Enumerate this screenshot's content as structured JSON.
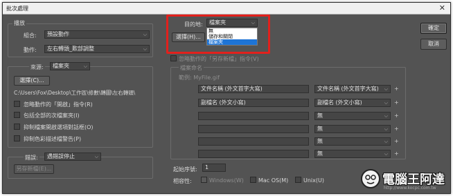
{
  "window": {
    "title": "批次處理",
    "close": "✕"
  },
  "play": {
    "group_label": "播放",
    "set_label": "組合:",
    "set_value": "預設動作",
    "action_label": "動作:",
    "action_value": "左右轉頭_歎部調整"
  },
  "source": {
    "label": "來源:",
    "value": "檔案夾",
    "choose": "選擇(C)...",
    "path": "C:\\Users\\Fox\\Desktop\\工作區\\修數\\轉圖\\左右轉頭\\",
    "options": [
      "忽略動作的「開啟」指令(R)",
      "包括全部的次檔案夾(I)",
      "抑制檔案開啟選項對話框(O)",
      "抑制色彩描述檔警告(P)"
    ]
  },
  "errors": {
    "label": "錯誤:",
    "value": "遇錯誤停止",
    "save_as": "另存新檔(E)..."
  },
  "destination": {
    "label": "目的地:",
    "value": "檔案夾",
    "choose": "選擇(H)...",
    "options": [
      "無",
      "儲存和關閉",
      "檔案夾"
    ],
    "override": "忽略動作的「另存新檔」指令(V)"
  },
  "naming": {
    "title": "檔案命名",
    "example": "範例: MyFile.gif",
    "left": [
      "文件名稱 (外文首字大寫)",
      "副檔名 (外文小寫)",
      "",
      "",
      "",
      ""
    ],
    "right": [
      "文件名稱 (外文首字大寫)",
      "副檔名 (外文小寫)",
      "無",
      "無",
      "無",
      "無"
    ],
    "serial_label": "起始序號:",
    "serial_value": "1",
    "compat_label": "相容性:",
    "compat": [
      "Windows(W)",
      "Mac OS(M)",
      "Unix(U)"
    ]
  },
  "buttons": {
    "ok": "確定",
    "cancel": "取消"
  },
  "watermark": {
    "text": "電腦王阿達",
    "url": "http://www.kocpc.com.tw"
  }
}
